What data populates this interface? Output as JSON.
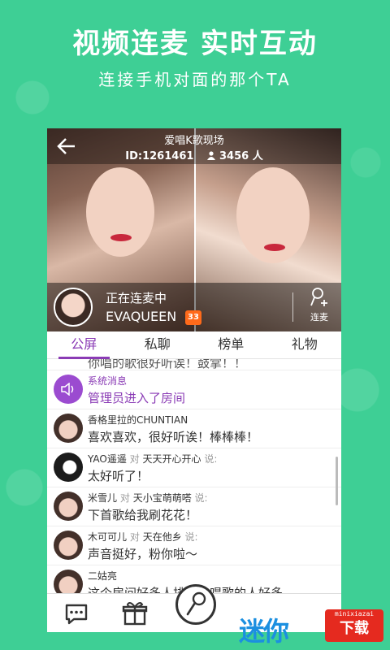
{
  "promo": {
    "title": "视频连麦 实时互动",
    "subtitle": "连接手机对面的那个TA"
  },
  "room": {
    "title": "爱唱K歌现场",
    "id_text": "ID:1261461",
    "viewers": "3456 人"
  },
  "host": {
    "status": "正在连麦中",
    "name": "EVAQUEEN",
    "level": "33",
    "mic_label": "连麦"
  },
  "tabs": [
    {
      "label": "公屏",
      "active": true
    },
    {
      "label": "私聊",
      "active": false
    },
    {
      "label": "榜单",
      "active": false
    },
    {
      "label": "礼物",
      "active": false
    }
  ],
  "chat": [
    {
      "user": "",
      "to": "",
      "text": "你唱的歌很好听诶！鼓掌！！",
      "type": "cut"
    },
    {
      "user": "系统消息",
      "to": "",
      "text": "管理员进入了房间",
      "type": "system"
    },
    {
      "user": "香格里拉的CHUNTIAN",
      "to": "",
      "text": "喜欢喜欢，很好听诶！棒棒棒！",
      "type": "user"
    },
    {
      "user": "YAO遥遥",
      "to": "天天开心开心",
      "text": "太好听了！",
      "type": "user"
    },
    {
      "user": "米雪儿",
      "to": "天小宝萌萌嗒",
      "text": "下首歌给我刷花花！",
      "type": "user"
    },
    {
      "user": "木可可儿",
      "to": "天在他乡",
      "text": "声音挺好，粉你啦～",
      "type": "user"
    },
    {
      "user": "二姑亮",
      "to": "",
      "text": "这个房间好多人排啊，唱歌的人好多，，",
      "type": "user"
    }
  ],
  "chat_labels": {
    "to_word": "对",
    "said_word": "说:"
  },
  "watermark": {
    "text": "迷你",
    "site": "minixiazai",
    "download": "下载"
  },
  "icons": [
    "back-arrow-icon",
    "person-icon",
    "mic-plus-icon",
    "speaker-icon",
    "chat-bubble-icon",
    "gift-icon",
    "mic-icon"
  ],
  "colors": {
    "background": "#3ecf95",
    "accent": "#8a3bb5"
  }
}
